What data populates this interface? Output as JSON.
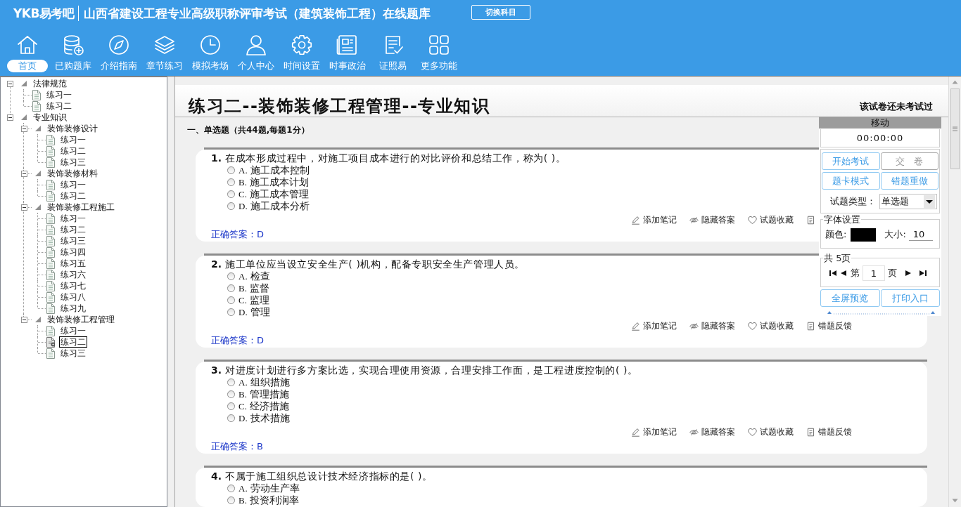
{
  "header": {
    "logo": "YKB易考吧",
    "title": "山西省建设工程专业高级职称评审考试（建筑装饰工程）在线题库",
    "switch_button": "切换科目"
  },
  "nav": [
    {
      "label": "首页",
      "selected": true
    },
    {
      "label": "已购题库",
      "selected": false
    },
    {
      "label": "介绍指南",
      "selected": false
    },
    {
      "label": "章节练习",
      "selected": false
    },
    {
      "label": "模拟考场",
      "selected": false
    },
    {
      "label": "个人中心",
      "selected": false
    },
    {
      "label": "时间设置",
      "selected": false
    },
    {
      "label": "时事政治",
      "selected": false
    },
    {
      "label": "证照易",
      "selected": false
    },
    {
      "label": "更多功能",
      "selected": false
    }
  ],
  "tree": [
    {
      "label": "法律规范",
      "expanded": true,
      "children": [
        {
          "label": "练习一",
          "selected": false
        },
        {
          "label": "练习二",
          "selected": false
        }
      ]
    },
    {
      "label": "专业知识",
      "expanded": true,
      "children": [
        {
          "label": "装饰装修设计",
          "expanded": true,
          "children": [
            {
              "label": "练习一",
              "selected": false
            },
            {
              "label": "练习二",
              "selected": false
            },
            {
              "label": "练习三",
              "selected": false
            }
          ]
        },
        {
          "label": "装饰装修材料",
          "expanded": true,
          "children": [
            {
              "label": "练习一",
              "selected": false
            },
            {
              "label": "练习二",
              "selected": false
            }
          ]
        },
        {
          "label": "装饰装修工程施工",
          "expanded": true,
          "children": [
            {
              "label": "练习一",
              "selected": false
            },
            {
              "label": "练习二",
              "selected": false
            },
            {
              "label": "练习三",
              "selected": false
            },
            {
              "label": "练习四",
              "selected": false
            },
            {
              "label": "练习五",
              "selected": false
            },
            {
              "label": "练习六",
              "selected": false
            },
            {
              "label": "练习七",
              "selected": false
            },
            {
              "label": "练习八",
              "selected": false
            },
            {
              "label": "练习九",
              "selected": false
            }
          ]
        },
        {
          "label": "装饰装修工程管理",
          "expanded": true,
          "children": [
            {
              "label": "练习一",
              "selected": false
            },
            {
              "label": "练习二",
              "selected": true
            },
            {
              "label": "练习三",
              "selected": false
            }
          ]
        }
      ]
    }
  ],
  "exam": {
    "title": "练习二--装饰装修工程管理--专业知识",
    "status": "该试卷还未考试过",
    "section": "一、单选题（共44题,每题1分）",
    "questions": [
      {
        "number": "1.",
        "text": "在成本形成过程中，对施工项目成本进行的对比评价和总结工作，称为( )。",
        "options": [
          {
            "letter": "A.",
            "text": "施工成本控制",
            "selected": false
          },
          {
            "letter": "B.",
            "text": "施工成本计划",
            "selected": false
          },
          {
            "letter": "C.",
            "text": "施工成本管理",
            "selected": false
          },
          {
            "letter": "D.",
            "text": "施工成本分析",
            "selected": false
          }
        ],
        "actions": [
          {
            "kind": "labeled",
            "label": "添加笔记"
          },
          {
            "kind": "labeled",
            "label": "隐藏答案"
          },
          {
            "kind": "labeled",
            "label": "试题收藏"
          },
          {
            "kind": "icon"
          }
        ],
        "answer": "正确答案：D"
      },
      {
        "number": "2.",
        "text": "施工单位应当设立安全生产( )机构，配备专职安全生产管理人员。",
        "options": [
          {
            "letter": "A.",
            "text": "检查",
            "selected": false
          },
          {
            "letter": "B.",
            "text": "监督",
            "selected": false
          },
          {
            "letter": "C.",
            "text": "监理",
            "selected": false
          },
          {
            "letter": "D.",
            "text": "管理",
            "selected": false
          }
        ],
        "actions": [
          {
            "kind": "labeled",
            "label": "添加笔记"
          },
          {
            "kind": "labeled",
            "label": "隐藏答案"
          },
          {
            "kind": "labeled",
            "label": "试题收藏"
          },
          {
            "kind": "labeled",
            "label": "错题反馈"
          }
        ],
        "answer": "正确答案：D"
      },
      {
        "number": "3.",
        "text": "对进度计划进行多方案比选，实现合理使用资源，合理安排工作面，是工程进度控制的( )。",
        "options": [
          {
            "letter": "A.",
            "text": "组织措施",
            "selected": false
          },
          {
            "letter": "B.",
            "text": "管理措施",
            "selected": false
          },
          {
            "letter": "C.",
            "text": "经济措施",
            "selected": false
          },
          {
            "letter": "D.",
            "text": "技术措施",
            "selected": false
          }
        ],
        "actions": [
          {
            "kind": "labeled",
            "label": "添加笔记"
          },
          {
            "kind": "labeled",
            "label": "隐藏答案"
          },
          {
            "kind": "labeled",
            "label": "试题收藏"
          },
          {
            "kind": "labeled",
            "label": "错题反馈"
          }
        ],
        "answer": "正确答案：B"
      },
      {
        "number": "4.",
        "text": "不属于施工组织总设计技术经济指标的是( )。",
        "options": [
          {
            "letter": "A.",
            "text": "劳动生产率",
            "selected": false
          },
          {
            "letter": "B.",
            "text": "投资利润率",
            "selected": false
          }
        ]
      }
    ]
  },
  "panel": {
    "header": "移动",
    "timer": "00:00:00",
    "buttons": [
      {
        "label": "开始考试",
        "disabled": false
      },
      {
        "label": "交　卷",
        "disabled": true
      },
      {
        "label": "题卡模式",
        "disabled": false
      },
      {
        "label": "错题重做",
        "disabled": false
      }
    ],
    "type_label": "试题类型：",
    "type_value": "单选题",
    "font": {
      "legend": "字体设置",
      "color_label": "颜色:",
      "color": "#000000",
      "size_label": "大小:",
      "size": "10"
    },
    "pager": {
      "legend": "共 5页",
      "prefix": "第",
      "page": "1",
      "suffix": "页"
    },
    "bottom_buttons": [
      {
        "label": "全屏预览"
      },
      {
        "label": "打印入口"
      }
    ]
  }
}
